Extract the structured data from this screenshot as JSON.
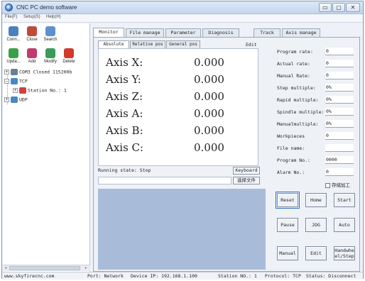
{
  "window": {
    "title": "CNC PC demo software",
    "controls": {
      "minimize": "▭",
      "maximize": "▢",
      "close": "✕"
    }
  },
  "menu": [
    "File(F)",
    "Setup(S)",
    "Help(H)"
  ],
  "toolbar": [
    {
      "label": "Conn...",
      "icon": "connect-icon",
      "color": "#4a7fc2"
    },
    {
      "label": "Close",
      "icon": "close-connection-icon",
      "color": "#c04a3a"
    },
    {
      "label": "Search",
      "icon": "search-icon",
      "color": "#5f8fcf"
    },
    {
      "label": "Upda...",
      "icon": "update-icon",
      "color": "#3aa04a"
    },
    {
      "label": "Add",
      "icon": "add-icon",
      "color": "#c23a6a"
    },
    {
      "label": "Modify",
      "icon": "modify-icon",
      "color": "#3c9a5a"
    },
    {
      "label": "Delete",
      "icon": "delete-icon",
      "color": "#d23a2a"
    }
  ],
  "tree": {
    "com": "COM3 Closed 115200b",
    "tcp": "TCP",
    "station": "Station No.: 1",
    "udp": "UDP"
  },
  "tabs": [
    "Monitor",
    "File manage",
    "Parameter",
    "Diagnosis",
    "Track",
    "Axis manage"
  ],
  "pos_tabs": [
    "Absolute pos",
    "Relative pos",
    "General pos"
  ],
  "edit_label": "Edit",
  "axes": [
    {
      "label": "Axis X:",
      "value": "0.000"
    },
    {
      "label": "Axis Y:",
      "value": "0.000"
    },
    {
      "label": "Axis Z:",
      "value": "0.000"
    },
    {
      "label": "Axis A:",
      "value": "0.000"
    },
    {
      "label": "Axis B:",
      "value": "0.000"
    },
    {
      "label": "Axis C:",
      "value": "0.000"
    }
  ],
  "running_state": "Running state: Stop",
  "keyboard_label": "Keyboard",
  "select_file_label": "选择文件",
  "stats": [
    {
      "label": "Program rate:",
      "value": "0"
    },
    {
      "label": "Actual rate:",
      "value": "0"
    },
    {
      "label": "Manual Rate:",
      "value": "0"
    },
    {
      "label": "Step multiple:",
      "value": "0%"
    },
    {
      "label": "Rapid multiple:",
      "value": "0%"
    },
    {
      "label": "Spindle multiple:",
      "value": "0%"
    },
    {
      "label": "Manualmultiple:",
      "value": "0%"
    },
    {
      "label": "Workpieces",
      "value": "0"
    },
    {
      "label": "File name:",
      "value": ""
    },
    {
      "label": "Program No.:",
      "value": "0000"
    },
    {
      "label": "Alarm No.:",
      "value": "0"
    }
  ],
  "checkbox_label": "存储加工",
  "buttons": {
    "reset": "Reset",
    "home": "Home",
    "start": "Start",
    "pause": "Pause",
    "jog": "JOG",
    "auto": "Auto",
    "manual": "Manual",
    "edit": "Edit",
    "handwheel_line1": "Handwhe",
    "handwheel_line2": "el/Step"
  },
  "statusbar": {
    "website": "www.skyfirecnc.com",
    "port": "Port: Network",
    "device_ip": "Device IP: 192.168.1.100",
    "station": "Station NO.: 1",
    "protocol": "Protocol: TCP",
    "status": "Status: Disconnect"
  }
}
